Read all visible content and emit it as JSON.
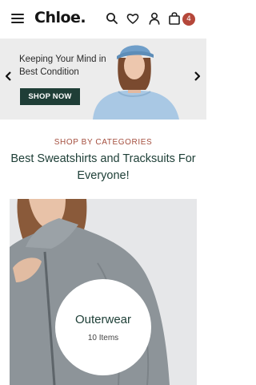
{
  "header": {
    "logo": "Chloe.",
    "cart_count": "4",
    "icons": [
      "menu-icon",
      "search-icon",
      "heart-icon",
      "user-icon",
      "cart-icon"
    ]
  },
  "hero": {
    "text": "Keeping Your Mind in Best Condition",
    "button_label": "SHOP NOW",
    "colors": {
      "background": "#ececec",
      "button": "#1f3e37"
    }
  },
  "categories_section": {
    "kicker": "SHOP BY CATEGORIES",
    "headline": "Best Sweatshirts and Tracksuits For Everyone!"
  },
  "category_card": {
    "title": "Outerwear",
    "count": "10 Items"
  },
  "colors": {
    "accent": "#a44e3e",
    "brand_green": "#1f4038",
    "badge": "#b5473a"
  }
}
